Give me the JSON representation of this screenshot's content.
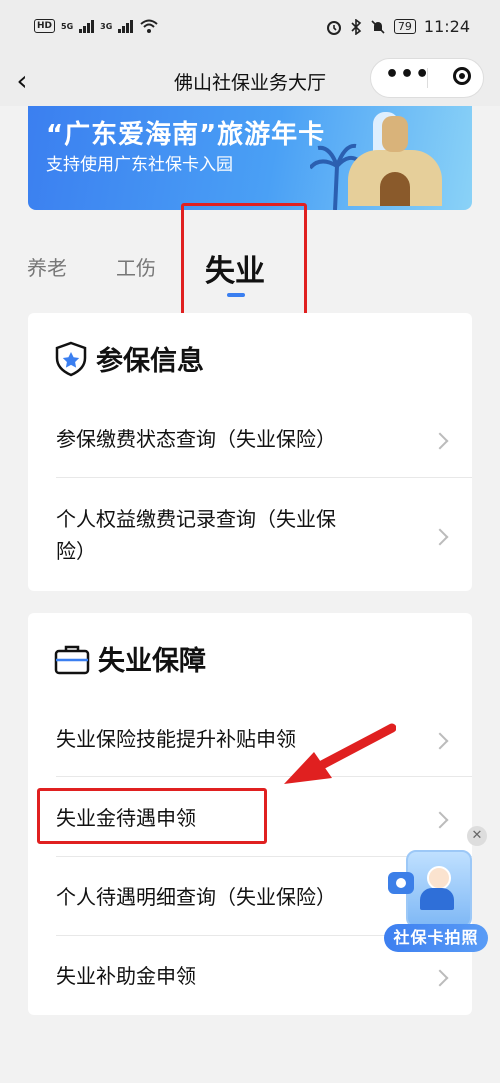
{
  "status_bar": {
    "left_badge": "HD",
    "sim1": "5G",
    "sim2": "3G",
    "battery": "79",
    "time": "11:24"
  },
  "nav": {
    "title": "佛山社保业务大厅",
    "more_label": "•••"
  },
  "banner": {
    "title": "“广东爱海南”旅游年卡",
    "subtitle": "支持使用广东社保卡入园"
  },
  "tabs": [
    {
      "label": "养老"
    },
    {
      "label": "工伤"
    },
    {
      "label": "失业",
      "active": true
    }
  ],
  "sections": [
    {
      "title": "参保信息",
      "icon": "shield-star-icon",
      "items": [
        {
          "label": "参保缴费状态查询（失业保险）"
        },
        {
          "label": "个人权益缴费记录查询（失业保",
          "label2": "险）"
        }
      ]
    },
    {
      "title": "失业保障",
      "icon": "briefcase-icon",
      "items": [
        {
          "label": "失业保险技能提升补贴申领"
        },
        {
          "label": "失业金待遇申领"
        },
        {
          "label": "个人待遇明细查询（失业保险）"
        },
        {
          "label": "失业补助金申领"
        }
      ]
    }
  ],
  "float_widget": {
    "label": "社保卡拍照",
    "close": "✕"
  },
  "colors": {
    "accent": "#3b7ff0",
    "annotation_red": "#e02020",
    "background": "#f2f2f2"
  }
}
